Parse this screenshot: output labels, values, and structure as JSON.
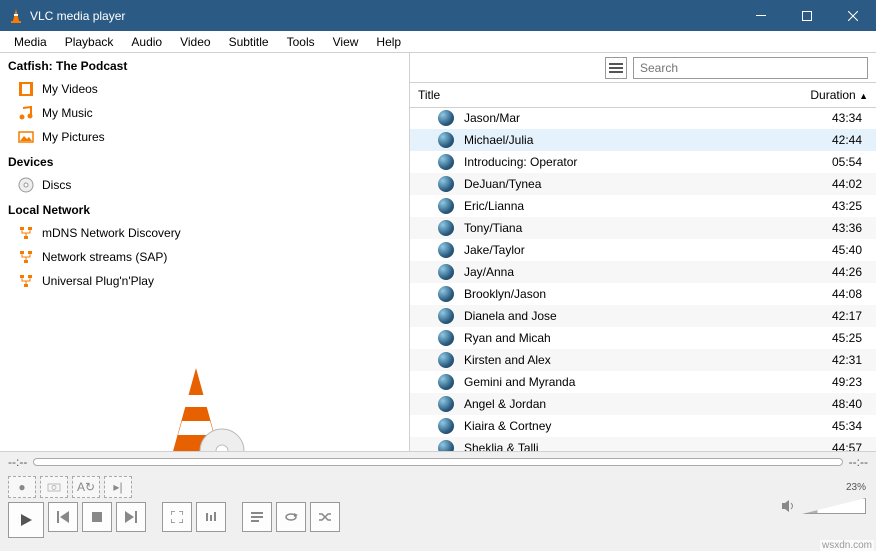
{
  "window": {
    "title": "VLC media player"
  },
  "menu": [
    "Media",
    "Playback",
    "Audio",
    "Video",
    "Subtitle",
    "Tools",
    "View",
    "Help"
  ],
  "sidebar": {
    "heading": "Catfish: The Podcast",
    "computer": [
      {
        "label": "My Videos"
      },
      {
        "label": "My Music"
      },
      {
        "label": "My Pictures"
      }
    ],
    "devicesHeading": "Devices",
    "devices": [
      {
        "label": "Discs"
      }
    ],
    "networkHeading": "Local Network",
    "network": [
      {
        "label": "mDNS Network Discovery"
      },
      {
        "label": "Network streams (SAP)"
      },
      {
        "label": "Universal Plug'n'Play"
      }
    ]
  },
  "search": {
    "placeholder": "Search"
  },
  "columns": {
    "title": "Title",
    "duration": "Duration"
  },
  "tracks": [
    {
      "title": "Jason/Mar",
      "duration": "43:34"
    },
    {
      "title": "Michael/Julia",
      "duration": "42:44",
      "selected": true
    },
    {
      "title": "Introducing: Operator",
      "duration": "05:54"
    },
    {
      "title": "DeJuan/Tynea",
      "duration": "44:02"
    },
    {
      "title": "Eric/Lianna",
      "duration": "43:25"
    },
    {
      "title": "Tony/Tiana",
      "duration": "43:36"
    },
    {
      "title": "Jake/Taylor",
      "duration": "45:40"
    },
    {
      "title": "Jay/Anna",
      "duration": "44:26"
    },
    {
      "title": "Brooklyn/Jason",
      "duration": "44:08"
    },
    {
      "title": "Dianela and Jose",
      "duration": "42:17"
    },
    {
      "title": "Ryan and Micah",
      "duration": "45:25"
    },
    {
      "title": "Kirsten and Alex",
      "duration": "42:31"
    },
    {
      "title": "Gemini and Myranda",
      "duration": "49:23"
    },
    {
      "title": "Angel & Jordan",
      "duration": "48:40"
    },
    {
      "title": "Kiaira & Cortney",
      "duration": "45:34"
    },
    {
      "title": "Sheklia & Talli",
      "duration": "44:57"
    }
  ],
  "seek": {
    "elapsed": "--:--",
    "remaining": "--:--"
  },
  "volume": {
    "percent": "23%"
  },
  "watermark": "wsxdn.com"
}
